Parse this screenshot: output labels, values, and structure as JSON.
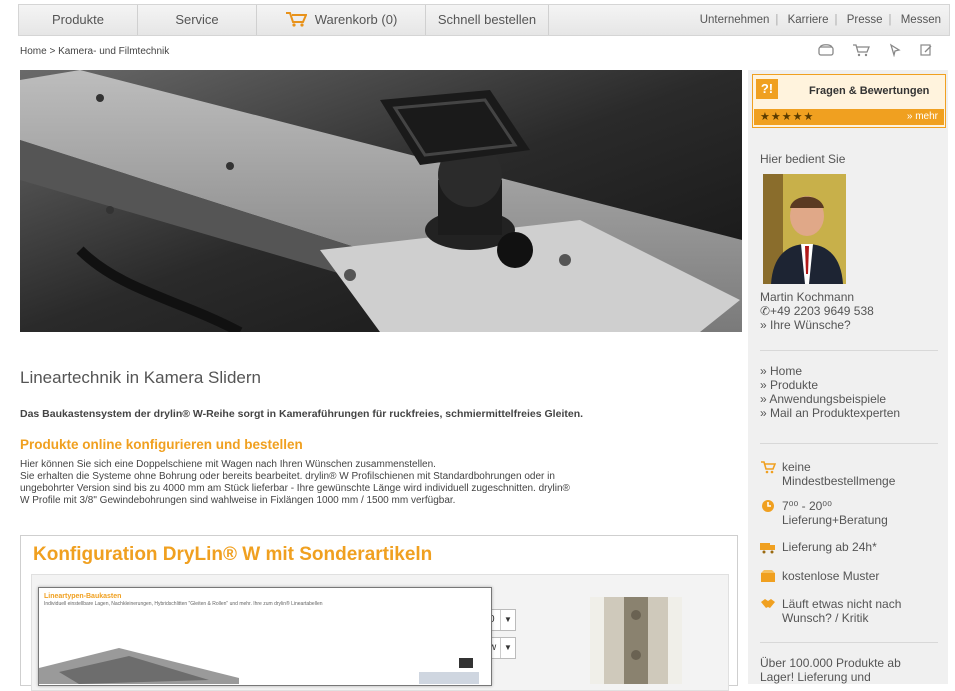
{
  "nav": {
    "tabs": [
      "Produkte",
      "Service",
      "Warenkorb (0)",
      "Schnell bestellen"
    ],
    "links": [
      "Unternehmen",
      "Karriere",
      "Presse",
      "Messen"
    ]
  },
  "breadcrumb": "Home > Kamera- und Filmtechnik",
  "content": {
    "title": "Lineartechnik in Kamera Slidern",
    "lead": "Das Baukastensystem der drylin® W-Reihe sorgt in Kameraführungen für ruckfreies, schmiermittelfreies Gleiten.",
    "subtitle": "Produkte online konfigurieren und bestellen",
    "body": [
      "Hier können Sie sich eine Doppelschiene mit Wagen nach Ihren Wünschen zusammenstellen.",
      "Sie erhalten die Systeme ohne Bohrung oder bereits bearbeitet. drylin® W Profilschienen mit Standardbohrungen oder in",
      "ungebohrter Version sind bis zu 4000 mm am Stück lieferbar - Ihre gewünschte Länge wird individuell zugeschnitten. drylin®",
      "W Profile mit 3/8\" Gewindebohrungen sind wahlweise in Fixlängen 1000 mm / 1500 mm verfügbar."
    ]
  },
  "config": {
    "title": "Konfiguration DryLin® W mit Sonderartikeln",
    "popup_title": "Lineartypen-Baukasten",
    "popup_text": "Individuell einstellbare Lagen, Nachkleinerungen, Hybridschlitten \"Gleiten & Rollen\" und mehr. Ihre zum drylin® Lineartabellen",
    "select1_value": "0",
    "select2_value": "w"
  },
  "sidebar": {
    "rating_badge": "?!",
    "rating_title": "Fragen & Bewertungen",
    "rating_stars": "★★★★★",
    "rating_more": "» mehr",
    "served_by": "Hier bedient Sie",
    "contact_name": "Martin Kochmann",
    "contact_phone": "✆+49 2203 9649 538",
    "contact_wishes": "» Ihre Wünsche?",
    "links": [
      "» Home",
      "» Produkte",
      "» Anwendungsbeispiele",
      "» Mail an Produktexperten"
    ],
    "features": [
      {
        "icon": "cart-icon",
        "text1": "keine",
        "text2": "Mindestbestellmenge"
      },
      {
        "icon": "clock-icon",
        "text1": "7⁰⁰ - 20⁰⁰",
        "text2": "Lieferung+Beratung"
      },
      {
        "icon": "truck-icon",
        "text1": "Lieferung ab 24h*",
        "text2": ""
      },
      {
        "icon": "box-icon",
        "text1": "kostenlose Muster",
        "text2": ""
      },
      {
        "icon": "handshake-icon",
        "text1": "Läuft etwas nicht nach",
        "text2": "Wunsch? / Kritik"
      }
    ],
    "bottom_text1": "Über 100.000 Produkte ab",
    "bottom_text2": "Lager! Lieferung und"
  },
  "colors": {
    "accent": "#f0a020",
    "nav_bg": "#ececec",
    "sidebar_bg": "#f0f0f0"
  }
}
